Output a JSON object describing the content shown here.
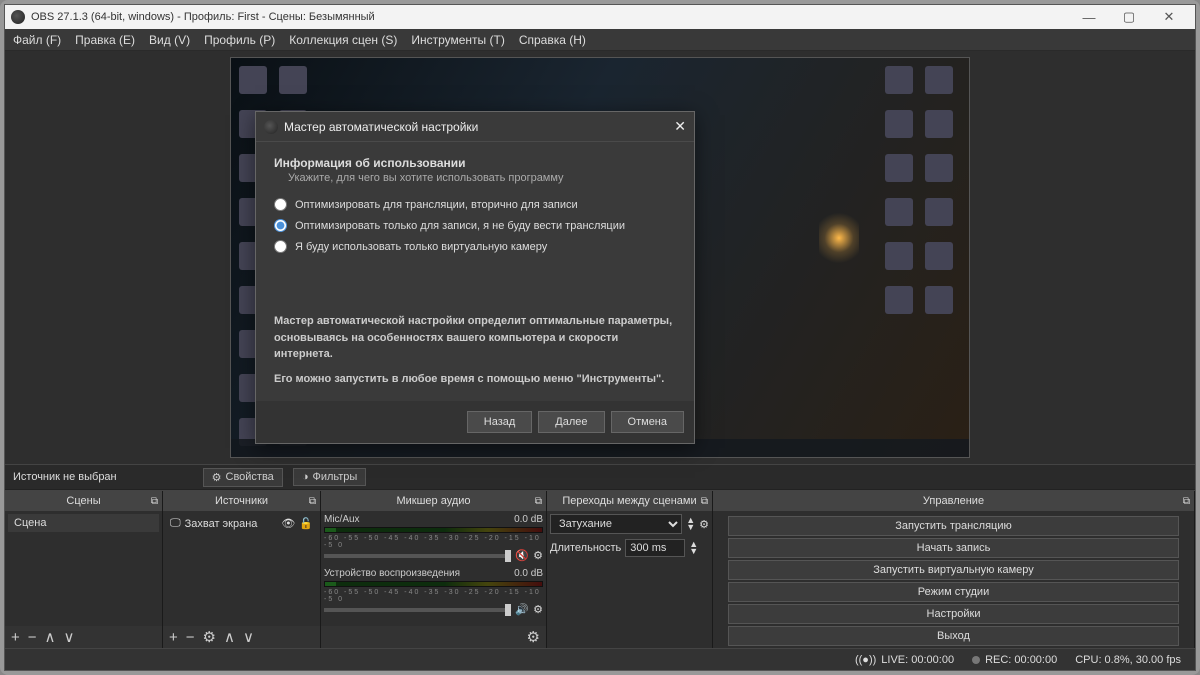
{
  "window": {
    "title": "OBS 27.1.3 (64-bit, windows) - Профиль: First - Сцены: Безымянный"
  },
  "menu": {
    "file": "Файл (F)",
    "edit": "Правка (E)",
    "view": "Вид (V)",
    "profile": "Профиль (P)",
    "scenecol": "Коллекция сцен (S)",
    "tools": "Инструменты (T)",
    "help": "Справка (H)"
  },
  "toolbar": {
    "no_selection": "Источник не выбран",
    "properties": "Свойства",
    "filters": "Фильтры"
  },
  "docks": {
    "scenes": {
      "title": "Сцены",
      "item": "Сцена"
    },
    "sources": {
      "title": "Источники",
      "item": "Захват экрана"
    },
    "mixer": {
      "title": "Микшер аудио",
      "ch1": {
        "name": "Mic/Aux",
        "level": "0.0 dB"
      },
      "ch2": {
        "name": "Устройство воспроизведения",
        "level": "0.0 dB"
      }
    },
    "transitions": {
      "title": "Переходы между сценами",
      "type": "Затухание",
      "duration_label": "Длительность",
      "duration_value": "300 ms"
    },
    "controls": {
      "title": "Управление",
      "stream": "Запустить трансляцию",
      "record": "Начать запись",
      "vcam": "Запустить виртуальную камеру",
      "studio": "Режим студии",
      "settings": "Настройки",
      "exit": "Выход"
    }
  },
  "status": {
    "live": "LIVE: 00:00:00",
    "rec": "REC: 00:00:00",
    "cpu": "CPU: 0.8%, 30.00 fps"
  },
  "wizard": {
    "title": "Мастер автоматической настройки",
    "heading": "Информация об использовании",
    "sub": "Укажите, для чего вы хотите использовать программу",
    "opt1": "Оптимизировать для трансляции, вторично для записи",
    "opt2": "Оптимизировать только для записи, я не буду вести трансляции",
    "opt3": "Я буду использовать только виртуальную камеру",
    "foot1": "Мастер автоматической настройки определит оптимальные параметры, основываясь на особенностях вашего компьютера и скорости интернета.",
    "foot2": "Его можно запустить в любое время с помощью меню \"Инструменты\".",
    "back": "Назад",
    "next": "Далее",
    "cancel": "Отмена"
  }
}
